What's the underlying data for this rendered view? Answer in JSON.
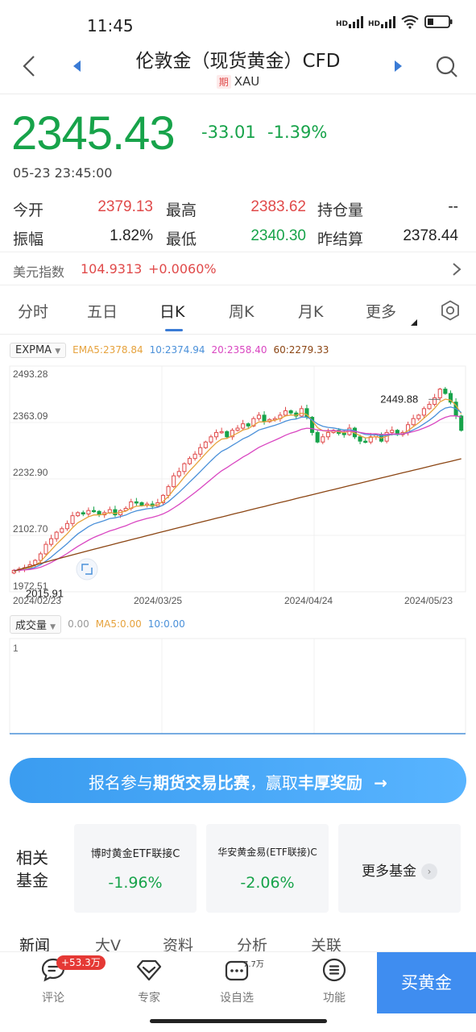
{
  "status": {
    "time": "11:45",
    "hd1": "HD",
    "hd2": "HD"
  },
  "header": {
    "title": "伦敦金（现货黄金）CFD",
    "tag": "期",
    "symbol": "XAU"
  },
  "quote": {
    "price": "2345.43",
    "change": "-33.01",
    "change_pct": "-1.39%",
    "time": "05-23 23:45:00"
  },
  "stats": {
    "open_label": "今开",
    "open": "2379.13",
    "high_label": "最高",
    "high": "2383.62",
    "oi_label": "持仓量",
    "oi": "--",
    "amp_label": "振幅",
    "amp": "1.82%",
    "low_label": "最低",
    "low": "2340.30",
    "prev_label": "昨结算",
    "prev": "2378.44"
  },
  "usd_index": {
    "label": "美元指数",
    "value": "104.9313",
    "change": "+0.0060%"
  },
  "tabs": {
    "t1": "分时",
    "t2": "五日",
    "t3": "日K",
    "t4": "周K",
    "t5": "月K",
    "t6": "更多"
  },
  "indicator": {
    "name": "EXPMA",
    "ema5": "EMA5:2378.84",
    "ema10": "10:2374.94",
    "ema20": "20:2358.40",
    "ema60": "60:2279.33",
    "colors": {
      "ema5": "#e6a23c",
      "ema10": "#4a90d9",
      "ema20": "#d946c1",
      "ema60": "#8b4513",
      "up": "#e04a4a",
      "down": "#17a34a"
    }
  },
  "chart_data": {
    "type": "candlestick",
    "y_ticks": [
      "2493.28",
      "2363.09",
      "2232.90",
      "2102.70",
      "1972.51"
    ],
    "ylim": [
      1972.51,
      2493.28
    ],
    "x_ticks": [
      "2024/02/23",
      "2024/03/25",
      "2024/04/24",
      "2024/05/23"
    ],
    "max_label": "2449.88",
    "min_label": "2015.91",
    "closes": [
      2022,
      2025,
      2028,
      2035,
      2045,
      2060,
      2082,
      2095,
      2110,
      2118,
      2130,
      2148,
      2155,
      2152,
      2160,
      2158,
      2150,
      2155,
      2162,
      2150,
      2160,
      2165,
      2180,
      2178,
      2172,
      2175,
      2170,
      2178,
      2195,
      2215,
      2240,
      2250,
      2268,
      2280,
      2290,
      2305,
      2318,
      2330,
      2340,
      2342,
      2330,
      2345,
      2350,
      2360,
      2355,
      2372,
      2380,
      2365,
      2370,
      2372,
      2380,
      2390,
      2385,
      2378,
      2395,
      2375,
      2340,
      2318,
      2330,
      2340,
      2345,
      2338,
      2335,
      2350,
      2330,
      2320,
      2318,
      2330,
      2335,
      2320,
      2340,
      2345,
      2335,
      2340,
      2358,
      2372,
      2380,
      2395,
      2405,
      2420,
      2440,
      2430,
      2410,
      2378,
      2345
    ],
    "ema60_start": 2020,
    "ema60_end": 2279.33,
    "volume": {
      "label": "成交量",
      "value": "0.00",
      "ma5": "MA5:0.00",
      "ma10": "10:0.00",
      "y_tick": "1"
    }
  },
  "banner": {
    "part1": "报名参与",
    "part2": "期货交易比赛",
    "part3": "，赢取",
    "part4": "丰厚奖励",
    "arrow": "→"
  },
  "funds": {
    "label_line1": "相关",
    "label_line2": "基金",
    "items": [
      {
        "name": "博时黄金ETF联接C",
        "change": "-1.96%"
      },
      {
        "name": "华安黄金易(ETF联接)C",
        "change": "-2.06%"
      }
    ],
    "more": "更多基金"
  },
  "news_tabs": {
    "n1": "新闻",
    "n2": "大V",
    "n3": "资料",
    "n4": "分析",
    "n5": "关联"
  },
  "bottom": {
    "comment": "评论",
    "comment_badge": "+53.3万",
    "expert": "专家",
    "watchlist": "设自选",
    "watch_count": "7.7万",
    "function": "功能",
    "buy": "买黄金"
  }
}
